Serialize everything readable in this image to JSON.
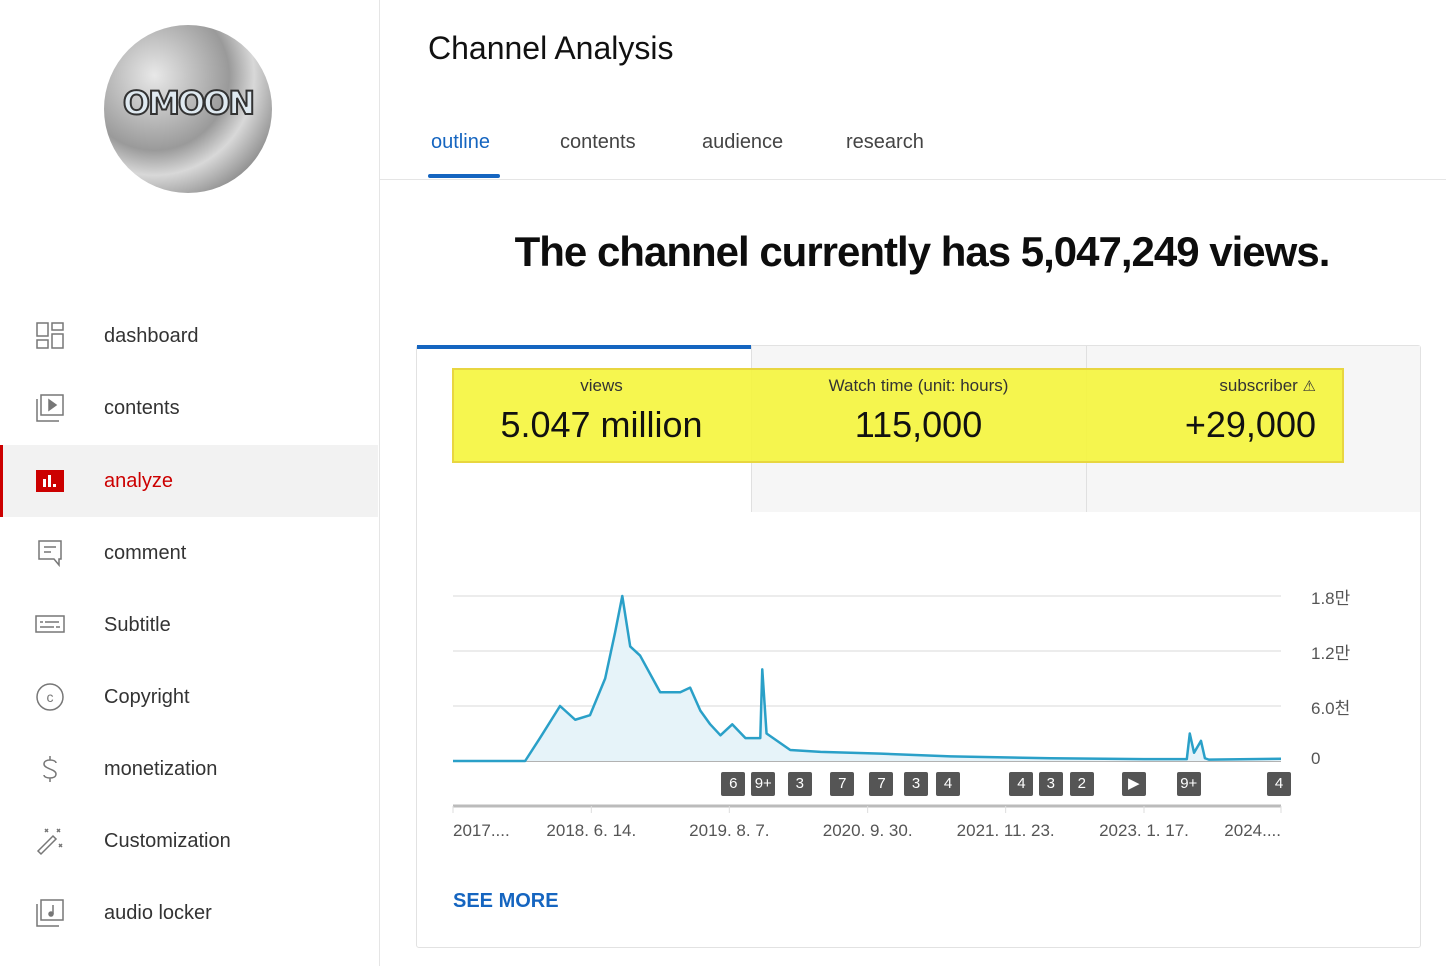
{
  "sidebar": {
    "avatar_logo_text": "OMOON",
    "items": [
      {
        "label": "dashboard",
        "icon": "dashboard-icon"
      },
      {
        "label": "contents",
        "icon": "video-library-icon"
      },
      {
        "label": "analyze",
        "icon": "analytics-icon",
        "active": true
      },
      {
        "label": "comment",
        "icon": "comment-icon"
      },
      {
        "label": "Subtitle",
        "icon": "subtitles-icon"
      },
      {
        "label": "Copyright",
        "icon": "copyright-icon"
      },
      {
        "label": "monetization",
        "icon": "dollar-icon"
      },
      {
        "label": "Customization",
        "icon": "magic-wand-icon"
      },
      {
        "label": "audio locker",
        "icon": "audio-library-icon"
      }
    ],
    "active_color": "#cc0000"
  },
  "header": {
    "title": "Channel Analysis",
    "tabs": [
      {
        "label": "outline",
        "active": true
      },
      {
        "label": "contents"
      },
      {
        "label": "audience"
      },
      {
        "label": "research"
      }
    ]
  },
  "headline": "The channel currently has 5,047,249 views.",
  "stats": [
    {
      "label": "views",
      "value": "5.047 million"
    },
    {
      "label": "Watch time (unit: hours)",
      "value": "115,000"
    },
    {
      "label": "subscriber",
      "value": "+29,000",
      "icon": "warning-icon"
    }
  ],
  "accent": "#1565c0",
  "highlight_color": "#f5f53c",
  "see_more": "SEE MORE",
  "chart_data": {
    "type": "area",
    "line_color": "#2aa0c8",
    "xlim": [
      "2017-04-20",
      "2024-03-08"
    ],
    "ylim": [
      0,
      18000
    ],
    "grid": true,
    "y_ticks": [
      {
        "value": 18000,
        "label": "1.8만"
      },
      {
        "value": 12000,
        "label": "1.2만"
      },
      {
        "value": 6000,
        "label": "6.0천"
      },
      {
        "value": 0,
        "label": "0"
      }
    ],
    "x_ticks": [
      {
        "date": "2017-04-20",
        "label": "2017...."
      },
      {
        "date": "2018-06-14",
        "label": "2018. 6. 14."
      },
      {
        "date": "2019-08-07",
        "label": "2019. 8. 7."
      },
      {
        "date": "2020-09-30",
        "label": "2020. 9. 30."
      },
      {
        "date": "2021-11-23",
        "label": "2021. 11. 23."
      },
      {
        "date": "2023-01-17",
        "label": "2023. 1. 17."
      },
      {
        "date": "2024-03-08",
        "label": "2024...."
      }
    ],
    "series": [
      {
        "points": [
          [
            "2017-04-20",
            0
          ],
          [
            "2017-11-25",
            0
          ],
          [
            "2018-01-09",
            2500
          ],
          [
            "2018-03-11",
            6000
          ],
          [
            "2018-04-26",
            4500
          ],
          [
            "2018-06-10",
            5000
          ],
          [
            "2018-07-26",
            9000
          ],
          [
            "2018-08-25",
            14000
          ],
          [
            "2018-09-16",
            18000
          ],
          [
            "2018-10-10",
            12500
          ],
          [
            "2018-11-09",
            11500
          ],
          [
            "2019-01-09",
            7500
          ],
          [
            "2019-03-11",
            7500
          ],
          [
            "2019-04-10",
            8000
          ],
          [
            "2019-05-11",
            5500
          ],
          [
            "2019-06-10",
            4000
          ],
          [
            "2019-07-11",
            2800
          ],
          [
            "2019-08-16",
            4000
          ],
          [
            "2019-09-25",
            2500
          ],
          [
            "2019-11-09",
            2500
          ],
          [
            "2019-11-15",
            10000
          ],
          [
            "2019-11-28",
            3000
          ],
          [
            "2020-02-08",
            1200
          ],
          [
            "2020-05-10",
            1000
          ],
          [
            "2020-11-08",
            800
          ],
          [
            "2021-06-09",
            500
          ],
          [
            "2022-04-09",
            300
          ],
          [
            "2023-02-07",
            200
          ],
          [
            "2023-05-27",
            200
          ],
          [
            "2023-06-05",
            3000
          ],
          [
            "2023-06-18",
            900
          ],
          [
            "2023-07-09",
            2200
          ],
          [
            "2023-07-21",
            300
          ],
          [
            "2023-08-02",
            150
          ],
          [
            "2024-03-08",
            250
          ]
        ]
      }
    ],
    "markers": [
      {
        "date": "2019-08-19",
        "label": "6"
      },
      {
        "date": "2019-11-18",
        "label": "9+"
      },
      {
        "date": "2020-03-08",
        "label": "3"
      },
      {
        "date": "2020-07-15",
        "label": "7"
      },
      {
        "date": "2020-11-11",
        "label": "7"
      },
      {
        "date": "2021-02-24",
        "label": "3"
      },
      {
        "date": "2021-06-01",
        "label": "4"
      },
      {
        "date": "2022-01-10",
        "label": "4"
      },
      {
        "date": "2022-04-09",
        "label": "3"
      },
      {
        "date": "2022-07-12",
        "label": "2"
      },
      {
        "date": "2022-12-17",
        "label": "▶"
      },
      {
        "date": "2023-06-02",
        "label": "9+"
      },
      {
        "date": "2024-03-02",
        "label": "4"
      }
    ]
  }
}
